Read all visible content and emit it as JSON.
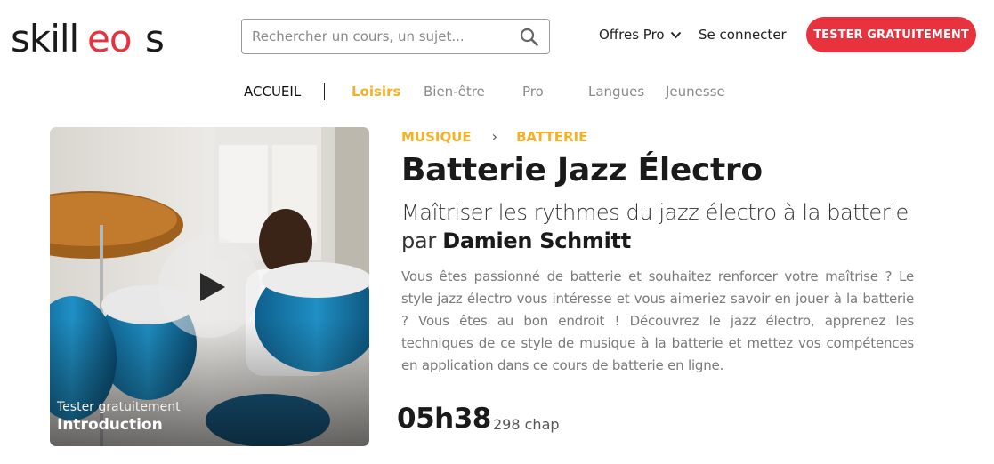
{
  "header": {
    "logo_text": "skilleos",
    "search_placeholder": "Rechercher un cours, un sujet...",
    "offres_label": "Offres Pro",
    "connect_label": "Se connecter",
    "cta_label": "TESTER GRATUITEMENT"
  },
  "nav": {
    "items": [
      {
        "label": "ACCUEIL"
      },
      {
        "label": "Loisirs"
      },
      {
        "label": "Bien-être"
      },
      {
        "label": "Pro"
      },
      {
        "label": "Langues"
      },
      {
        "label": "Jeunesse"
      }
    ]
  },
  "video": {
    "try_label": "Tester gratuitement",
    "chapter_label": "Introduction"
  },
  "course": {
    "breadcrumb": [
      "MUSIQUE",
      "BATTERIE"
    ],
    "title": "Batterie Jazz Électro",
    "subtitle": "Maîtriser les rythmes du jazz électro à la batterie",
    "by_prefix": "par",
    "author": "Damien Schmitt",
    "description": "Vous êtes passionné de batterie et souhaitez renforcer votre maîtrise ? Le style jazz électro vous intéresse et vous aimeriez savoir en jouer à la batterie ? Vous êtes au bon endroit ! Découvrez le jazz électro, apprenez les techniques de ce style de musique à la batterie et mettez vos compétences en application dans ce cours de batterie en ligne.",
    "duration": "05h38",
    "chapters": "298 chap"
  },
  "colors": {
    "brand_red": "#e8333e",
    "accent_yellow": "#f4b127",
    "text_dark": "#1a1a1a",
    "text_muted": "#7a7a7a"
  },
  "icons": [
    "search-icon",
    "chevron-down-icon",
    "play-icon",
    "chevron-right-icon"
  ]
}
